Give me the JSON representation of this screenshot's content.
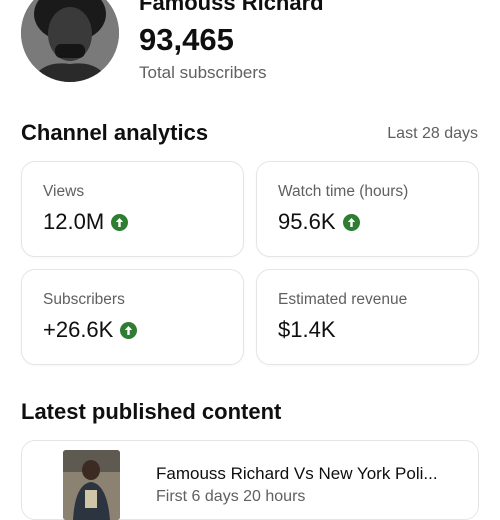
{
  "channel": {
    "name": "Famouss Richard",
    "subscriber_count": "93,465",
    "subscriber_label": "Total subscribers"
  },
  "analytics": {
    "title": "Channel analytics",
    "range": "Last 28 days",
    "metrics": [
      {
        "label": "Views",
        "value": "12.0M",
        "trend": "up"
      },
      {
        "label": "Watch time (hours)",
        "value": "95.6K",
        "trend": "up"
      },
      {
        "label": "Subscribers",
        "value": "+26.6K",
        "trend": "up"
      },
      {
        "label": "Estimated revenue",
        "value": "$1.4K",
        "trend": "none"
      }
    ],
    "trend_color": "#2e7d32"
  },
  "latest": {
    "title": "Latest published content",
    "video": {
      "title": "Famouss Richard Vs New York Poli...",
      "meta": "First 6 days 20 hours"
    }
  }
}
